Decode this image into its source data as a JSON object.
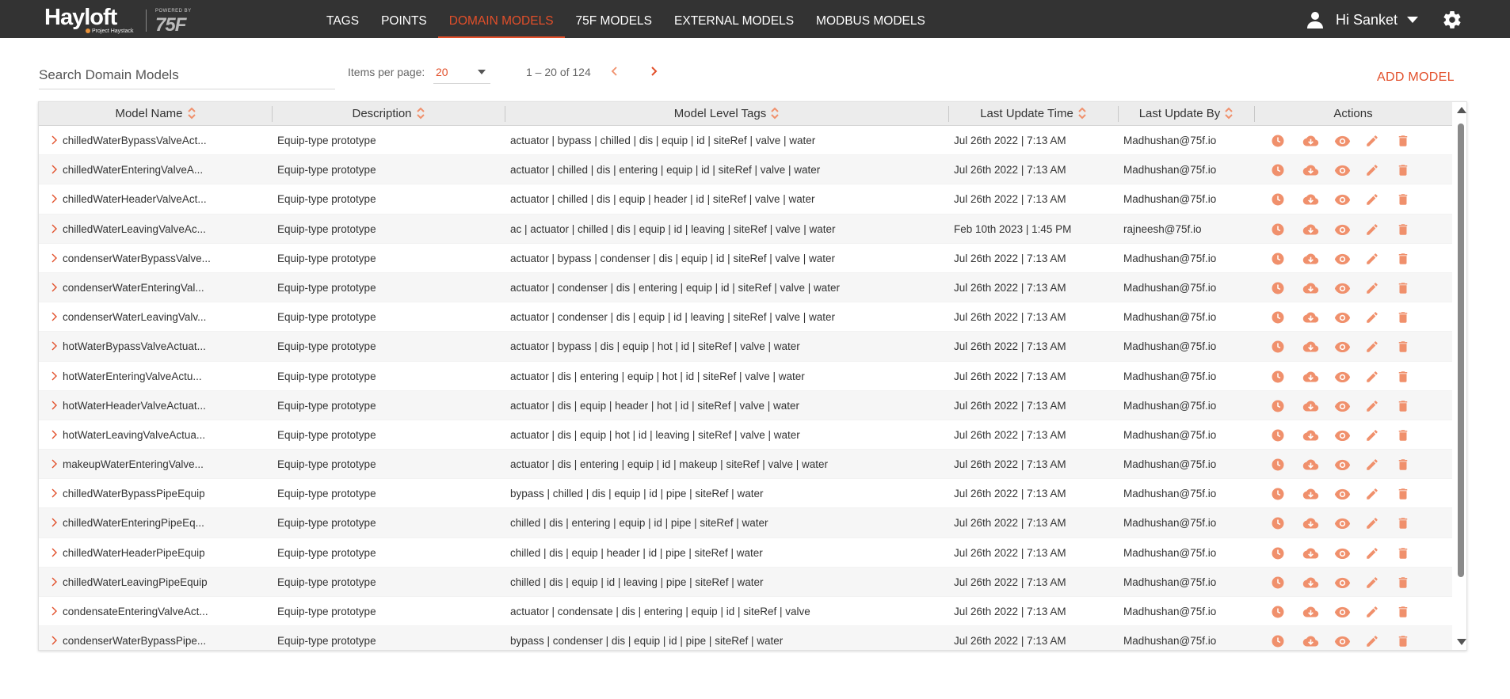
{
  "brand": {
    "name": "Hayloft",
    "tagline": "Project Haystack",
    "powered_by": "POWERED BY",
    "partner": "75F"
  },
  "nav": {
    "items": [
      {
        "label": "TAGS"
      },
      {
        "label": "POINTS"
      },
      {
        "label": "DOMAIN MODELS",
        "active": true
      },
      {
        "label": "75F MODELS"
      },
      {
        "label": "EXTERNAL MODELS"
      },
      {
        "label": "MODBUS MODELS"
      }
    ]
  },
  "user": {
    "greeting": "Hi Sanket",
    "icon": "person-icon"
  },
  "settings": {
    "icon": "gear-icon"
  },
  "toolbar": {
    "search_placeholder": "Search Domain Models",
    "items_per_page_label": "Items per page:",
    "items_per_page_value": "20",
    "range_label": "1 – 20 of 124",
    "add_model_label": "ADD MODEL"
  },
  "table": {
    "headers": {
      "name": "Model Name",
      "description": "Description",
      "tags": "Model Level Tags",
      "time": "Last Update Time",
      "by": "Last Update By",
      "actions": "Actions"
    },
    "action_icons": [
      "history-icon",
      "download-icon",
      "view-icon",
      "edit-icon",
      "delete-icon"
    ],
    "rows": [
      {
        "name": "chilledWaterBypassValveAct...",
        "description": "Equip-type prototype",
        "tags": "actuator | bypass | chilled | dis | equip | id | siteRef | valve | water",
        "time": "Jul 26th 2022 | 7:13 AM",
        "by": "Madhushan@75f.io"
      },
      {
        "name": "chilledWaterEnteringValveA...",
        "description": "Equip-type prototype",
        "tags": "actuator | chilled | dis | entering | equip | id | siteRef | valve | water",
        "time": "Jul 26th 2022 | 7:13 AM",
        "by": "Madhushan@75f.io"
      },
      {
        "name": "chilledWaterHeaderValveAct...",
        "description": "Equip-type prototype",
        "tags": "actuator | chilled | dis | equip | header | id | siteRef | valve | water",
        "time": "Jul 26th 2022 | 7:13 AM",
        "by": "Madhushan@75f.io"
      },
      {
        "name": "chilledWaterLeavingValveAc...",
        "description": "Equip-type prototype",
        "tags": "ac | actuator | chilled | dis | equip | id | leaving | siteRef | valve | water",
        "time": "Feb 10th 2023 | 1:45 PM",
        "by": "rajneesh@75f.io"
      },
      {
        "name": "condenserWaterBypassValve...",
        "description": "Equip-type prototype",
        "tags": "actuator | bypass | condenser | dis | equip | id | siteRef | valve | water",
        "time": "Jul 26th 2022 | 7:13 AM",
        "by": "Madhushan@75f.io"
      },
      {
        "name": "condenserWaterEnteringVal...",
        "description": "Equip-type prototype",
        "tags": "actuator | condenser | dis | entering | equip | id | siteRef | valve | water",
        "time": "Jul 26th 2022 | 7:13 AM",
        "by": "Madhushan@75f.io"
      },
      {
        "name": "condenserWaterLeavingValv...",
        "description": "Equip-type prototype",
        "tags": "actuator | condenser | dis | equip | id | leaving | siteRef | valve | water",
        "time": "Jul 26th 2022 | 7:13 AM",
        "by": "Madhushan@75f.io"
      },
      {
        "name": "hotWaterBypassValveActuat...",
        "description": "Equip-type prototype",
        "tags": "actuator | bypass | dis | equip | hot | id | siteRef | valve | water",
        "time": "Jul 26th 2022 | 7:13 AM",
        "by": "Madhushan@75f.io"
      },
      {
        "name": "hotWaterEnteringValveActu...",
        "description": "Equip-type prototype",
        "tags": "actuator | dis | entering | equip | hot | id | siteRef | valve | water",
        "time": "Jul 26th 2022 | 7:13 AM",
        "by": "Madhushan@75f.io"
      },
      {
        "name": "hotWaterHeaderValveActuat...",
        "description": "Equip-type prototype",
        "tags": "actuator | dis | equip | header | hot | id | siteRef | valve | water",
        "time": "Jul 26th 2022 | 7:13 AM",
        "by": "Madhushan@75f.io"
      },
      {
        "name": "hotWaterLeavingValveActua...",
        "description": "Equip-type prototype",
        "tags": "actuator | dis | equip | hot | id | leaving | siteRef | valve | water",
        "time": "Jul 26th 2022 | 7:13 AM",
        "by": "Madhushan@75f.io"
      },
      {
        "name": "makeupWaterEnteringValve...",
        "description": "Equip-type prototype",
        "tags": "actuator | dis | entering | equip | id | makeup | siteRef | valve | water",
        "time": "Jul 26th 2022 | 7:13 AM",
        "by": "Madhushan@75f.io"
      },
      {
        "name": "chilledWaterBypassPipeEquip",
        "description": "Equip-type prototype",
        "tags": "bypass | chilled | dis | equip | id | pipe | siteRef | water",
        "time": "Jul 26th 2022 | 7:13 AM",
        "by": "Madhushan@75f.io"
      },
      {
        "name": "chilledWaterEnteringPipeEq...",
        "description": "Equip-type prototype",
        "tags": "chilled | dis | entering | equip | id | pipe | siteRef | water",
        "time": "Jul 26th 2022 | 7:13 AM",
        "by": "Madhushan@75f.io"
      },
      {
        "name": "chilledWaterHeaderPipeEquip",
        "description": "Equip-type prototype",
        "tags": "chilled | dis | equip | header | id | pipe | siteRef | water",
        "time": "Jul 26th 2022 | 7:13 AM",
        "by": "Madhushan@75f.io"
      },
      {
        "name": "chilledWaterLeavingPipeEquip",
        "description": "Equip-type prototype",
        "tags": "chilled | dis | equip | id | leaving | pipe | siteRef | water",
        "time": "Jul 26th 2022 | 7:13 AM",
        "by": "Madhushan@75f.io"
      },
      {
        "name": "condensateEnteringValveAct...",
        "description": "Equip-type prototype",
        "tags": "actuator | condensate | dis | entering | equip | id | siteRef | valve",
        "time": "Jul 26th 2022 | 7:13 AM",
        "by": "Madhushan@75f.io"
      },
      {
        "name": "condenserWaterBypassPipe...",
        "description": "Equip-type prototype",
        "tags": "bypass | condenser | dis | equip | id | pipe | siteRef | water",
        "time": "Jul 26th 2022 | 7:13 AM",
        "by": "Madhushan@75f.io"
      }
    ]
  },
  "colors": {
    "accent": "#e24f2a",
    "icon_orange": "#f0906c",
    "topbar": "#333333",
    "header_bg": "#ececec"
  }
}
